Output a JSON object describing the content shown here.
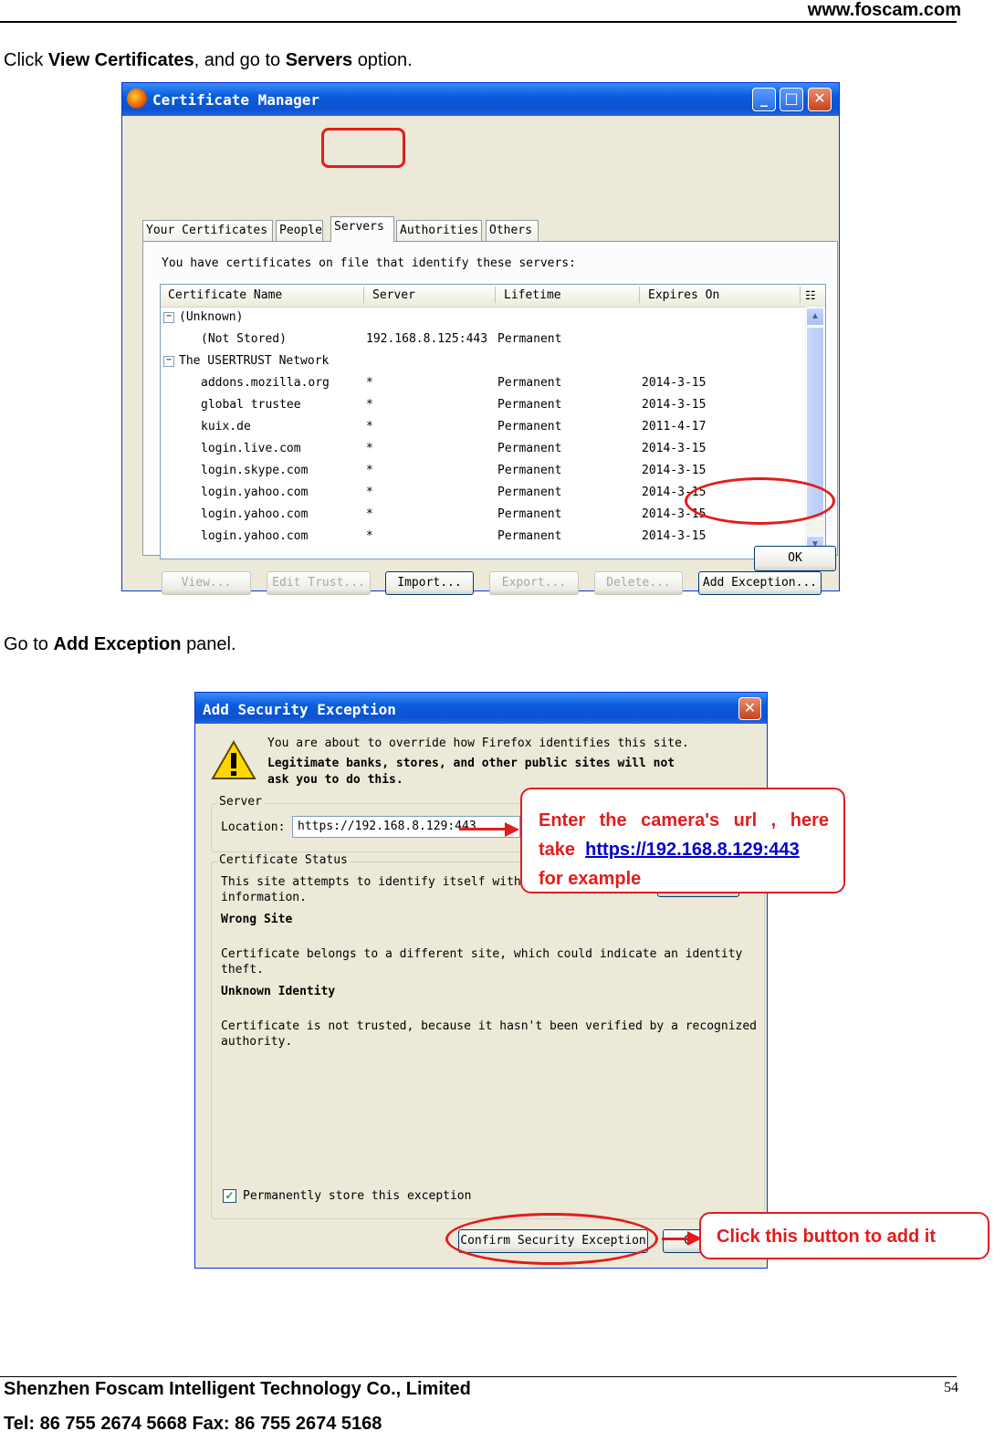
{
  "header": {
    "site_url": "www.foscam.com"
  },
  "intro": {
    "click": "Click",
    "view_certificates": "View Certificates",
    "and_go_to": ", and go to",
    "servers": "Servers",
    "option": "option."
  },
  "cert_manager": {
    "title": "Certificate Manager",
    "tabs": [
      "Your Certificates",
      "People",
      "Servers",
      "Authorities",
      "Others"
    ],
    "active_tab": "Servers",
    "description": "You have certificates on file that identify these servers:",
    "columns": [
      "Certificate Name",
      "Server",
      "Lifetime",
      "Expires On"
    ],
    "groups": [
      {
        "name": "(Unknown)",
        "rows": [
          {
            "name": "(Not Stored)",
            "server": "192.168.8.125:443",
            "lifetime": "Permanent",
            "expires": ""
          }
        ]
      },
      {
        "name": "The USERTRUST Network",
        "rows": [
          {
            "name": "addons.mozilla.org",
            "server": "*",
            "lifetime": "Permanent",
            "expires": "2014-3-15"
          },
          {
            "name": "global trustee",
            "server": "*",
            "lifetime": "Permanent",
            "expires": "2014-3-15"
          },
          {
            "name": "kuix.de",
            "server": "*",
            "lifetime": "Permanent",
            "expires": "2011-4-17"
          },
          {
            "name": "login.live.com",
            "server": "*",
            "lifetime": "Permanent",
            "expires": "2014-3-15"
          },
          {
            "name": "login.skype.com",
            "server": "*",
            "lifetime": "Permanent",
            "expires": "2014-3-15"
          },
          {
            "name": "login.yahoo.com",
            "server": "*",
            "lifetime": "Permanent",
            "expires": "2014-3-15"
          },
          {
            "name": "login.yahoo.com",
            "server": "*",
            "lifetime": "Permanent",
            "expires": "2014-3-15"
          },
          {
            "name": "login.yahoo.com",
            "server": "*",
            "lifetime": "Permanent",
            "expires": "2014-3-15"
          }
        ]
      }
    ],
    "buttons": {
      "view": "View...",
      "edit_trust": "Edit Trust...",
      "import": "Import...",
      "export": "Export...",
      "delete": "Delete...",
      "add_exception": "Add Exception...",
      "ok": "OK"
    }
  },
  "step2": {
    "go_to": "Go to",
    "add_exception": "Add Exception",
    "panel": "panel."
  },
  "add_exception": {
    "title": "Add Security Exception",
    "warning_line1": "You are about to override how Firefox identifies this site.",
    "warning_line2": "Legitimate banks, stores, and other public sites will not",
    "warning_line3": "ask you to do this.",
    "server_legend": "Server",
    "location_label": "Location:",
    "location_value": "https://192.168.8.129:443",
    "status_legend": "Certificate Status",
    "status_line1": "This site attempts to identify itself with i",
    "status_line2": "information.",
    "wrong_site": "Wrong Site",
    "wrong_site_desc1": "Certificate belongs to a different site, which could indicate an identity",
    "wrong_site_desc2": "theft.",
    "unknown_identity": "Unknown Identity",
    "unknown_desc1": "Certificate is not trusted, because it hasn't been verified by a recognized",
    "unknown_desc2": "authority.",
    "permanent_label": "Permanently store this exception",
    "permanent_checked": true,
    "confirm_button": "Confirm Security Exception",
    "cancel_button_partial": "C"
  },
  "callouts": {
    "url_prefix": "Enter  the  camera's  url  ,  here take",
    "url_link": "https://192.168.8.129:443",
    "url_suffix": "for example",
    "click_button": "Click this button to add it"
  },
  "footer": {
    "company": "Shenzhen Foscam Intelligent Technology Co., Limited",
    "tel": "Tel: 86 755 2674 5668 Fax: 86 755 2674 5168",
    "page_number": "54"
  },
  "colors": {
    "annotation_red": "#e31c1c",
    "link_blue": "#0000cc",
    "xp_blue": "#0a5cdc"
  }
}
